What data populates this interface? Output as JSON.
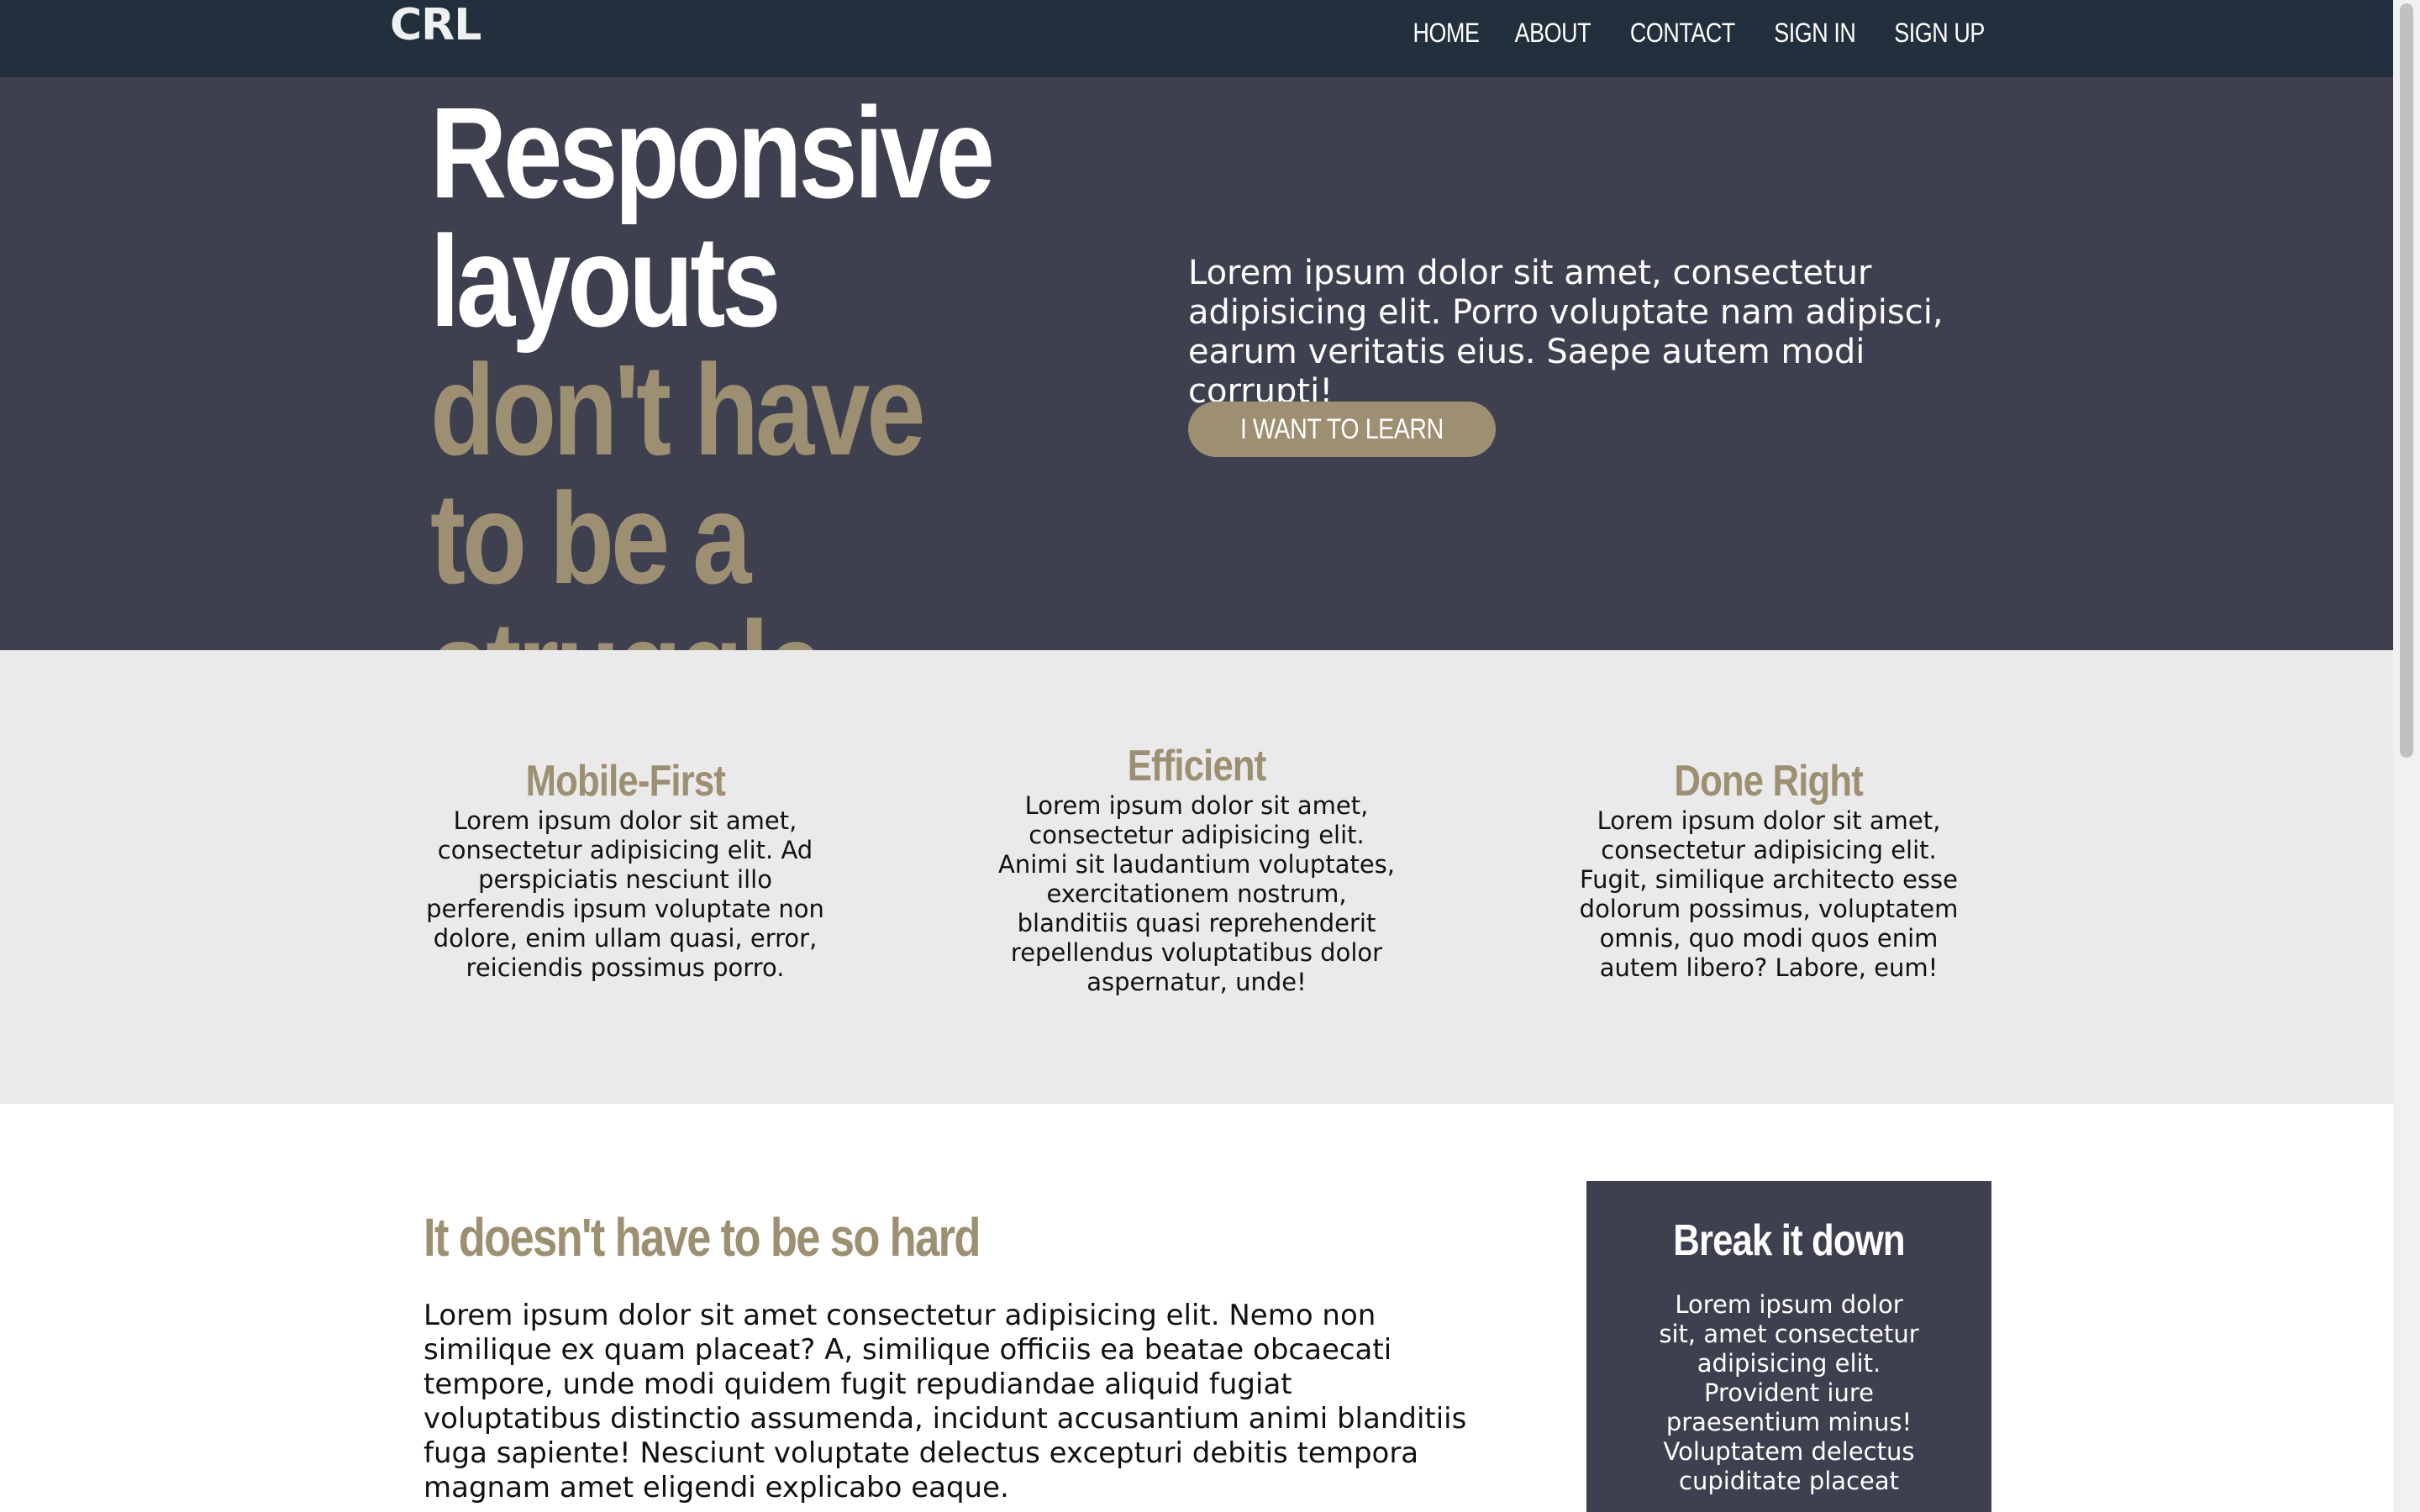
{
  "nav": {
    "logo": "CRL",
    "links": [
      "HOME",
      "ABOUT",
      "CONTACT",
      "SIGN IN",
      "SIGN UP"
    ]
  },
  "hero": {
    "title_plain": "Responsive layouts",
    "title_accent": "don't have to be a struggle",
    "description": "Lorem ipsum dolor sit amet, consectetur adipisicing elit. Porro voluptate nam adipisci, earum veritatis eius. Saepe autem modi corrupti!",
    "button": "I WANT TO LEARN"
  },
  "features": [
    {
      "title": "Mobile-First",
      "text": "Lorem ipsum dolor sit amet, consectetur adipisicing elit. Ad perspiciatis nesciunt illo perferendis ipsum voluptate non dolore, enim ullam quasi, error, reiciendis possimus porro."
    },
    {
      "title": "Efficient",
      "text": "Lorem ipsum dolor sit amet, consectetur adipisicing elit. Animi sit laudantium voluptates, exercitationem nostrum, blanditiis quasi reprehenderit repellendus voluptatibus dolor aspernatur, unde!"
    },
    {
      "title": "Done Right",
      "text": "Lorem ipsum dolor sit amet, consectetur adipisicing elit. Fugit, similique architecto esse dolorum possimus, voluptatem omnis, quo modi quos enim autem libero? Labore, eum!"
    }
  ],
  "content": {
    "title": "It doesn't have to be so hard",
    "body": "Lorem ipsum dolor sit amet consectetur adipisicing elit. Nemo non similique ex quam placeat? A, similique officiis ea beatae obcaecati tempore, unde modi quidem fugit repudiandae aliquid fugiat voluptatibus distinctio assumenda, incidunt accusantium animi blanditiis fuga sapiente! Nesciunt voluptate delectus excepturi debitis tempora magnam amet eligendi explicabo eaque."
  },
  "sidebar": {
    "title": "Break it down",
    "text": "Lorem ipsum dolor sit, amet consectetur adipisicing elit. Provident iure praesentium minus! Voluptatem delectus cupiditate placeat"
  },
  "colors": {
    "nav_bg": "#222f3c",
    "hero_bg": "#3e4050",
    "accent": "#9d8f72",
    "features_bg": "#eaeaea"
  }
}
